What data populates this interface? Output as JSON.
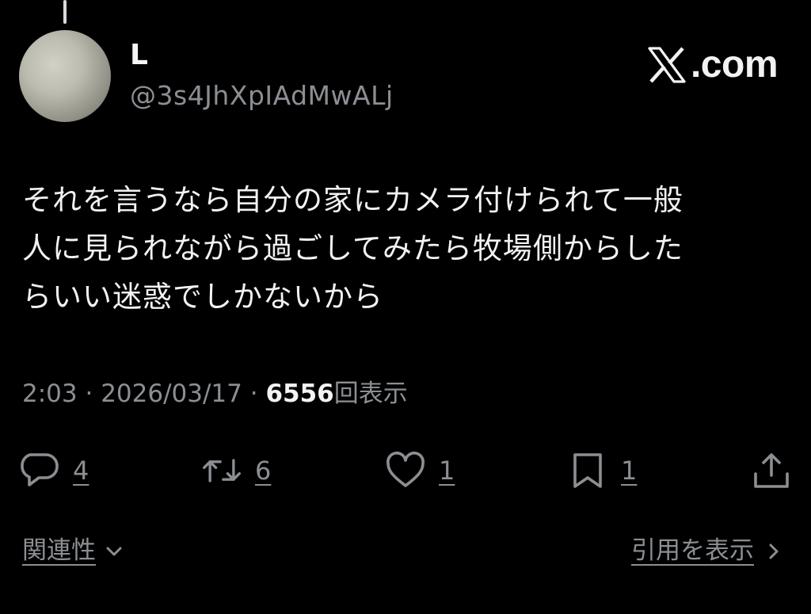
{
  "user": {
    "display_name": "L",
    "handle": "@3s4JhXpIAdMwALj"
  },
  "brand": {
    "icon": "x-logo-icon",
    "text": ".com"
  },
  "tweet": {
    "text": "それを言うなら自分の家にカメラ付けられて一般\n人に見られながら過ごしてみたら牧場側からした\nらいい迷惑でしかないから"
  },
  "meta": {
    "time": "2:03",
    "separator": "·",
    "date": "2026/03/17",
    "views": "6556",
    "views_label": "回表示"
  },
  "actions": {
    "reply": {
      "icon": "reply-icon",
      "count": "4"
    },
    "retweet": {
      "icon": "retweet-icon",
      "count": "6"
    },
    "like": {
      "icon": "heart-icon",
      "count": "1"
    },
    "bookmark": {
      "icon": "bookmark-icon",
      "count": "1"
    },
    "share": {
      "icon": "share-icon"
    }
  },
  "footer": {
    "related_label": "関連性",
    "quotes_label": "引用を表示"
  },
  "colors": {
    "background": "#000000",
    "text_primary": "#f2f2f2",
    "text_secondary": "#8b8f93"
  }
}
